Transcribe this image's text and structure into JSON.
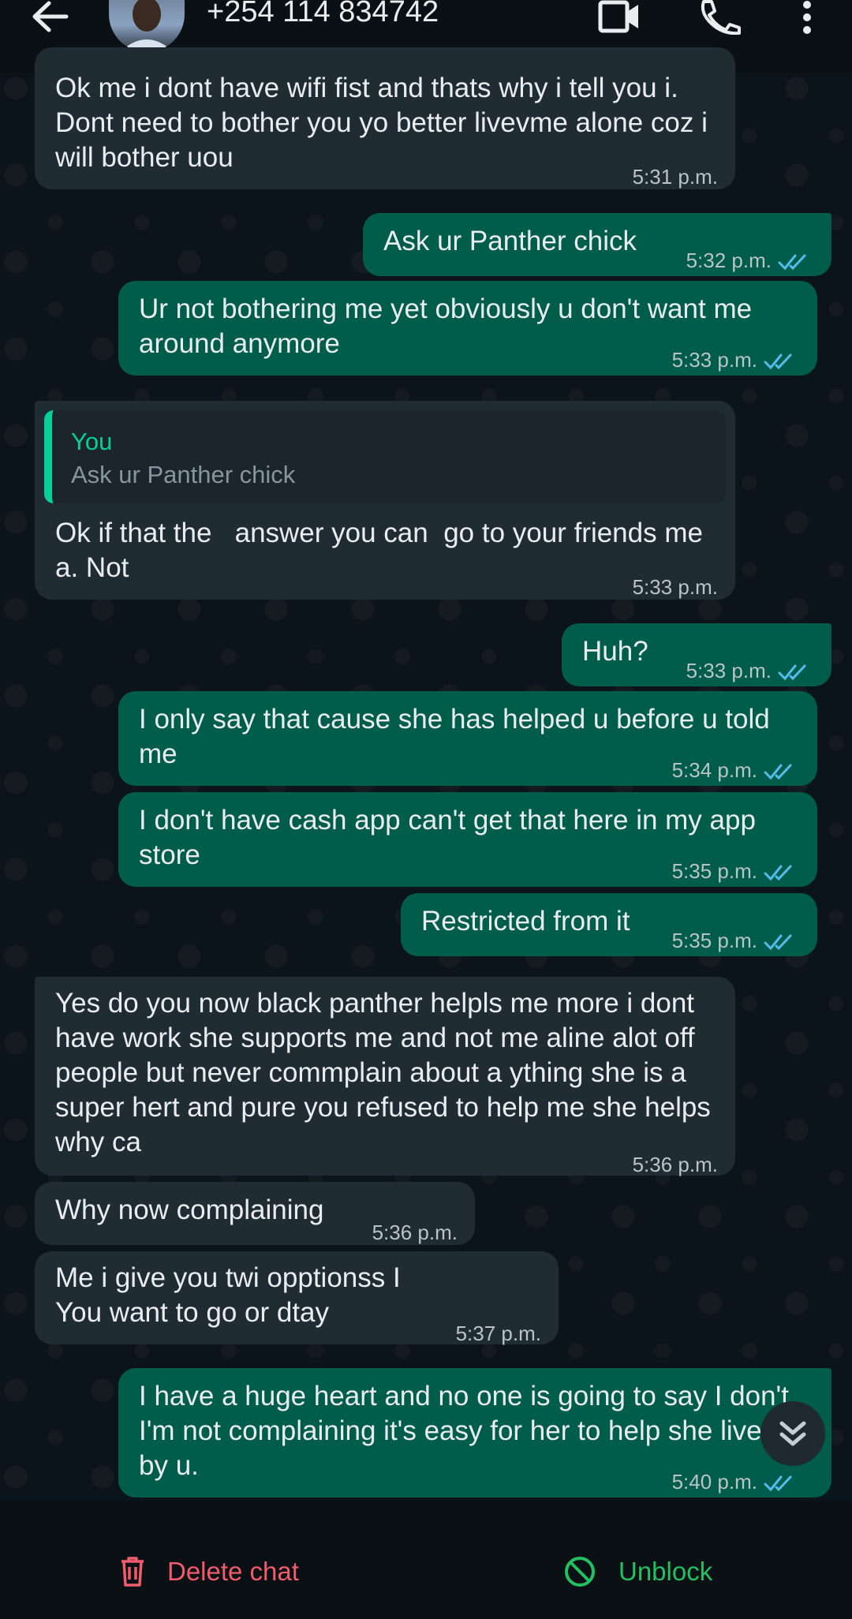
{
  "header": {
    "contact_title": "+254 114 834742",
    "icons": [
      "back-arrow-icon",
      "video-call-icon",
      "phone-icon",
      "more-options-icon"
    ]
  },
  "messages": [
    {
      "direction": "in",
      "text": "Ok me i dont have wifi fist and thats why i tell you i. Dont need to bother you yo better livevme alone coz i will bother uou",
      "time": "5:31 p.m."
    },
    {
      "direction": "out",
      "text": "Ask ur Panther chick",
      "time": "5:32 p.m."
    },
    {
      "direction": "out",
      "text": "Ur not bothering me yet obviously u don't want me around anymore",
      "time": "5:33 p.m."
    },
    {
      "direction": "in",
      "quote": {
        "author": "You",
        "text": "Ask ur Panther chick"
      },
      "text": "Ok if that the   answer you can  go to your friends me a. Not",
      "time": "5:33 p.m."
    },
    {
      "direction": "out",
      "text": "Huh?",
      "time": "5:33 p.m."
    },
    {
      "direction": "out",
      "text": "I only say that cause she has helped u before u told me",
      "time": "5:34 p.m."
    },
    {
      "direction": "out",
      "text": "I don't have cash app can't get that here in my app store",
      "time": "5:35 p.m."
    },
    {
      "direction": "out",
      "text": "Restricted from it",
      "time": "5:35 p.m."
    },
    {
      "direction": "in",
      "text": "Yes do you now black panther helpls me more i dont have work she supports me and not me aline alot off people but never commplain about a ything she is a super hert and pure you refused to help me she helps why ca",
      "time": "5:36 p.m."
    },
    {
      "direction": "in",
      "text": "Why now complaining",
      "time": "5:36 p.m."
    },
    {
      "direction": "in",
      "text": "Me i give you twi opptionss I\nYou want to go or dtay",
      "time": "5:37 p.m."
    },
    {
      "direction": "out",
      "text": "I have a huge heart and no one is going to say I don't. I'm not complaining it's easy for her to help she lives by u.",
      "time": "5:40 p.m."
    }
  ],
  "footer": {
    "delete_label": "Delete chat",
    "unblock_label": "Unblock"
  },
  "colors": {
    "outgoing_bubble": "#005c4b",
    "incoming_bubble": "#202c33",
    "read_ticks": "#53bdeb",
    "delete_red": "#f15c6d",
    "unblock_green": "#21c063",
    "quote_accent": "#06cf9c"
  }
}
